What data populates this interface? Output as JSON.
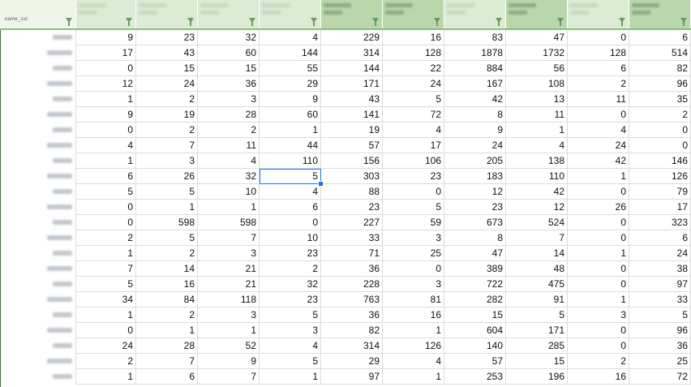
{
  "sheet": {
    "header": {
      "first_label": "name_1st",
      "columns": [
        {
          "name": "col-2"
        },
        {
          "name": "col-3"
        },
        {
          "name": "col-4"
        },
        {
          "name": "col-5"
        },
        {
          "name": "col-6"
        },
        {
          "name": "col-7"
        },
        {
          "name": "col-8"
        },
        {
          "name": "col-9"
        },
        {
          "name": "col-10"
        },
        {
          "name": "col-11"
        }
      ]
    },
    "rows": [
      [
        "9",
        "23",
        "32",
        "4",
        "229",
        "16",
        "83",
        "47",
        "0",
        "6"
      ],
      [
        "17",
        "43",
        "60",
        "144",
        "314",
        "128",
        "1878",
        "1732",
        "128",
        "514"
      ],
      [
        "0",
        "15",
        "15",
        "55",
        "144",
        "22",
        "884",
        "56",
        "6",
        "82"
      ],
      [
        "12",
        "24",
        "36",
        "29",
        "171",
        "24",
        "167",
        "108",
        "2",
        "96"
      ],
      [
        "1",
        "2",
        "3",
        "9",
        "43",
        "5",
        "42",
        "13",
        "11",
        "35"
      ],
      [
        "9",
        "19",
        "28",
        "60",
        "141",
        "72",
        "8",
        "11",
        "0",
        "2"
      ],
      [
        "0",
        "2",
        "2",
        "1",
        "19",
        "4",
        "9",
        "1",
        "4",
        "0"
      ],
      [
        "4",
        "7",
        "11",
        "44",
        "57",
        "17",
        "24",
        "4",
        "24",
        "0"
      ],
      [
        "1",
        "3",
        "4",
        "110",
        "156",
        "106",
        "205",
        "138",
        "42",
        "146"
      ],
      [
        "6",
        "26",
        "32",
        "5",
        "303",
        "23",
        "183",
        "110",
        "1",
        "126"
      ],
      [
        "5",
        "5",
        "10",
        "4",
        "88",
        "0",
        "12",
        "42",
        "0",
        "79"
      ],
      [
        "0",
        "1",
        "1",
        "6",
        "23",
        "5",
        "23",
        "12",
        "26",
        "17"
      ],
      [
        "0",
        "598",
        "598",
        "0",
        "227",
        "59",
        "673",
        "524",
        "0",
        "323"
      ],
      [
        "2",
        "5",
        "7",
        "10",
        "33",
        "3",
        "8",
        "7",
        "0",
        "6"
      ],
      [
        "1",
        "2",
        "3",
        "23",
        "71",
        "25",
        "47",
        "14",
        "1",
        "24"
      ],
      [
        "7",
        "14",
        "21",
        "2",
        "36",
        "0",
        "389",
        "48",
        "0",
        "38"
      ],
      [
        "5",
        "16",
        "21",
        "32",
        "228",
        "3",
        "722",
        "475",
        "0",
        "97"
      ],
      [
        "34",
        "84",
        "118",
        "23",
        "763",
        "81",
        "282",
        "91",
        "1",
        "33"
      ],
      [
        "1",
        "2",
        "3",
        "5",
        "36",
        "16",
        "15",
        "5",
        "3",
        "5"
      ],
      [
        "0",
        "1",
        "1",
        "3",
        "82",
        "1",
        "604",
        "171",
        "0",
        "96"
      ],
      [
        "24",
        "28",
        "52",
        "4",
        "314",
        "126",
        "140",
        "285",
        "0",
        "36"
      ],
      [
        "2",
        "7",
        "9",
        "5",
        "29",
        "4",
        "57",
        "15",
        "2",
        "25"
      ],
      [
        "1",
        "6",
        "7",
        "1",
        "97",
        "1",
        "253",
        "196",
        "16",
        "72"
      ]
    ],
    "selected_cell": {
      "row": 9,
      "col": 3
    }
  }
}
